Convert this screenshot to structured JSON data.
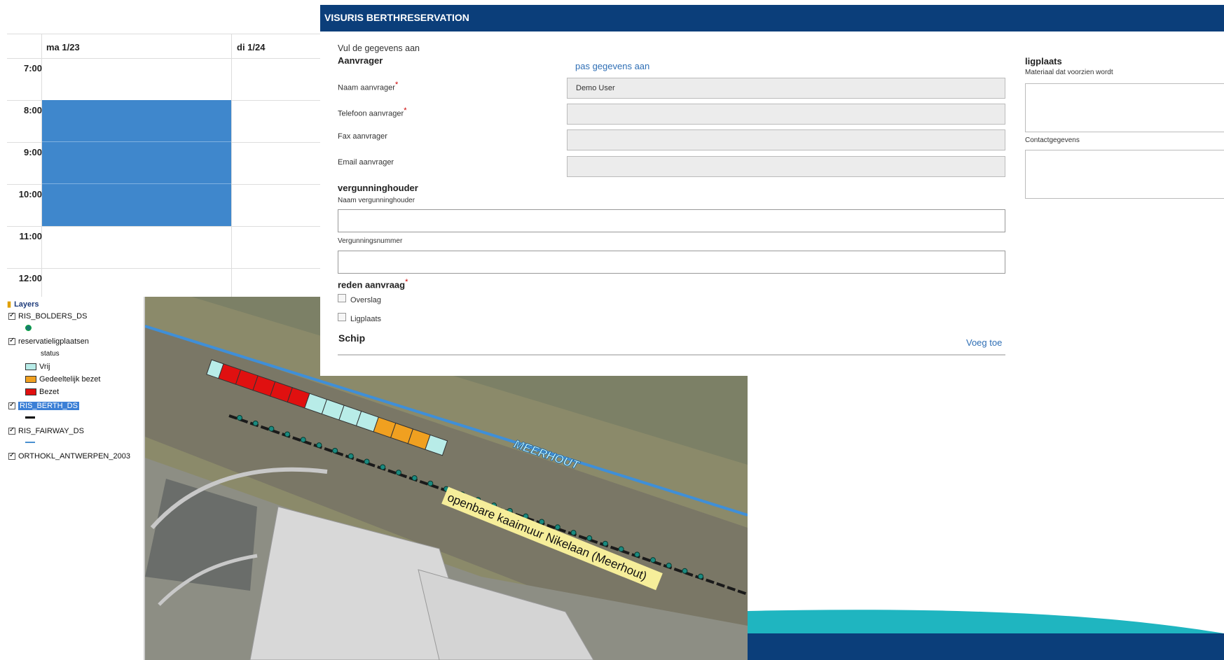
{
  "calendar": {
    "days": [
      "ma 1/23",
      "di 1/24"
    ],
    "times": [
      "7:00",
      "8:00",
      "9:00",
      "10:00",
      "11:00",
      "12:00"
    ]
  },
  "layers": {
    "title": "Layers",
    "items": [
      {
        "label": "RIS_BOLDERS_DS",
        "checked": true
      },
      {
        "label": "reservatieligplaatsen",
        "checked": true,
        "sublabel": "status"
      },
      {
        "label": "Vrij",
        "color": "#b8ece8"
      },
      {
        "label": "Gedeeltelijk bezet",
        "color": "#f0a020"
      },
      {
        "label": "Bezet",
        "color": "#e01010"
      },
      {
        "label": "RIS_BERTH_DS",
        "checked": true
      },
      {
        "label": "RIS_FAIRWAY_DS",
        "checked": true
      },
      {
        "label": "ORTHOKL_ANTWERPEN_2003",
        "checked": true
      }
    ]
  },
  "map": {
    "labels": {
      "waterway": "MEERHOUT",
      "quay": "openbare kaaimuur Nikelaan (Meerhout)"
    }
  },
  "form": {
    "header_title": "VISURIS BERTHRESERVATION",
    "intro": "Vul de gegevens aan",
    "aanvrager": {
      "heading": "Aanvrager",
      "edit_link": "pas gegevens aan",
      "name_label": "Naam aanvrager",
      "name_value": "Demo User",
      "phone_label": "Telefoon aanvrager",
      "fax_label": "Fax aanvrager",
      "email_label": "Email aanvrager"
    },
    "vergunning": {
      "heading": "vergunninghouder",
      "name_label": "Naam vergunninghouder",
      "number_label": "Vergunningsnummer"
    },
    "reden": {
      "heading": "reden aanvraag",
      "options": [
        "Overslag",
        "Ligplaats"
      ]
    },
    "schip": {
      "heading": "Schip",
      "add_link": "Voeg toe"
    },
    "ligplaats": {
      "heading": "ligplaats",
      "material_label": "Materiaal dat voorzien wordt",
      "contact_label": "Contactgegevens"
    },
    "required_marker": "*"
  },
  "colors": {
    "header": "#0b3e7a",
    "event": "#3f87cc",
    "link": "#2f6fb5",
    "berth_free": "#b8ece8",
    "berth_partial": "#f0a020",
    "berth_occupied": "#e01010"
  }
}
